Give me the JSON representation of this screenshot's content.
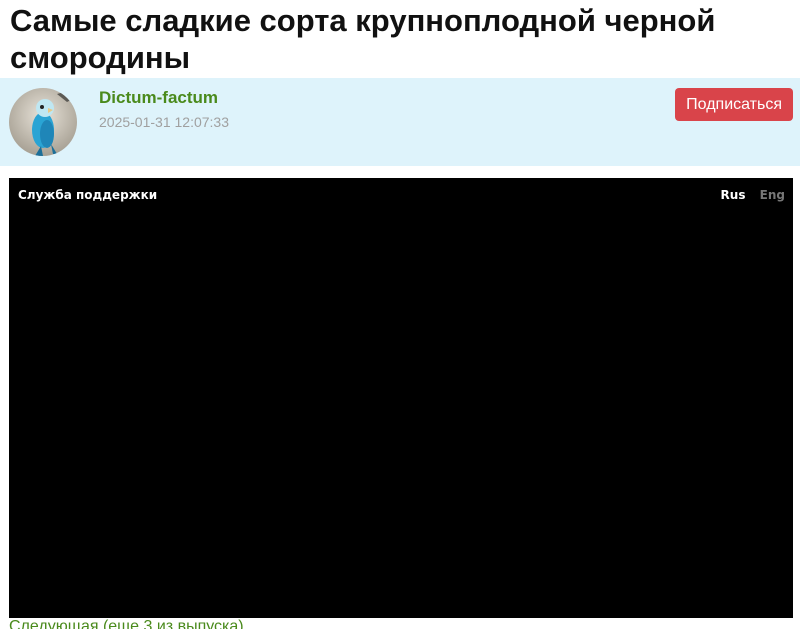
{
  "article": {
    "title": "Самые сладкие сорта крупноплодной черной смородины"
  },
  "author": {
    "name": "Dictum-factum",
    "date": "2025-01-31 12:07:33",
    "avatar_icon": "parrot-avatar",
    "subscribe_label": "Подписаться"
  },
  "video": {
    "support_label": "Служба поддержки",
    "lang_rus": "Rus",
    "lang_eng": "Eng"
  },
  "next": {
    "label": "Следующая (еще 3 из выпуска)"
  },
  "colors": {
    "author_bar_bg": "#def3fb",
    "author_name": "#4a8a1c",
    "subscribe_bg": "#d9444a",
    "video_bg": "#000000"
  }
}
